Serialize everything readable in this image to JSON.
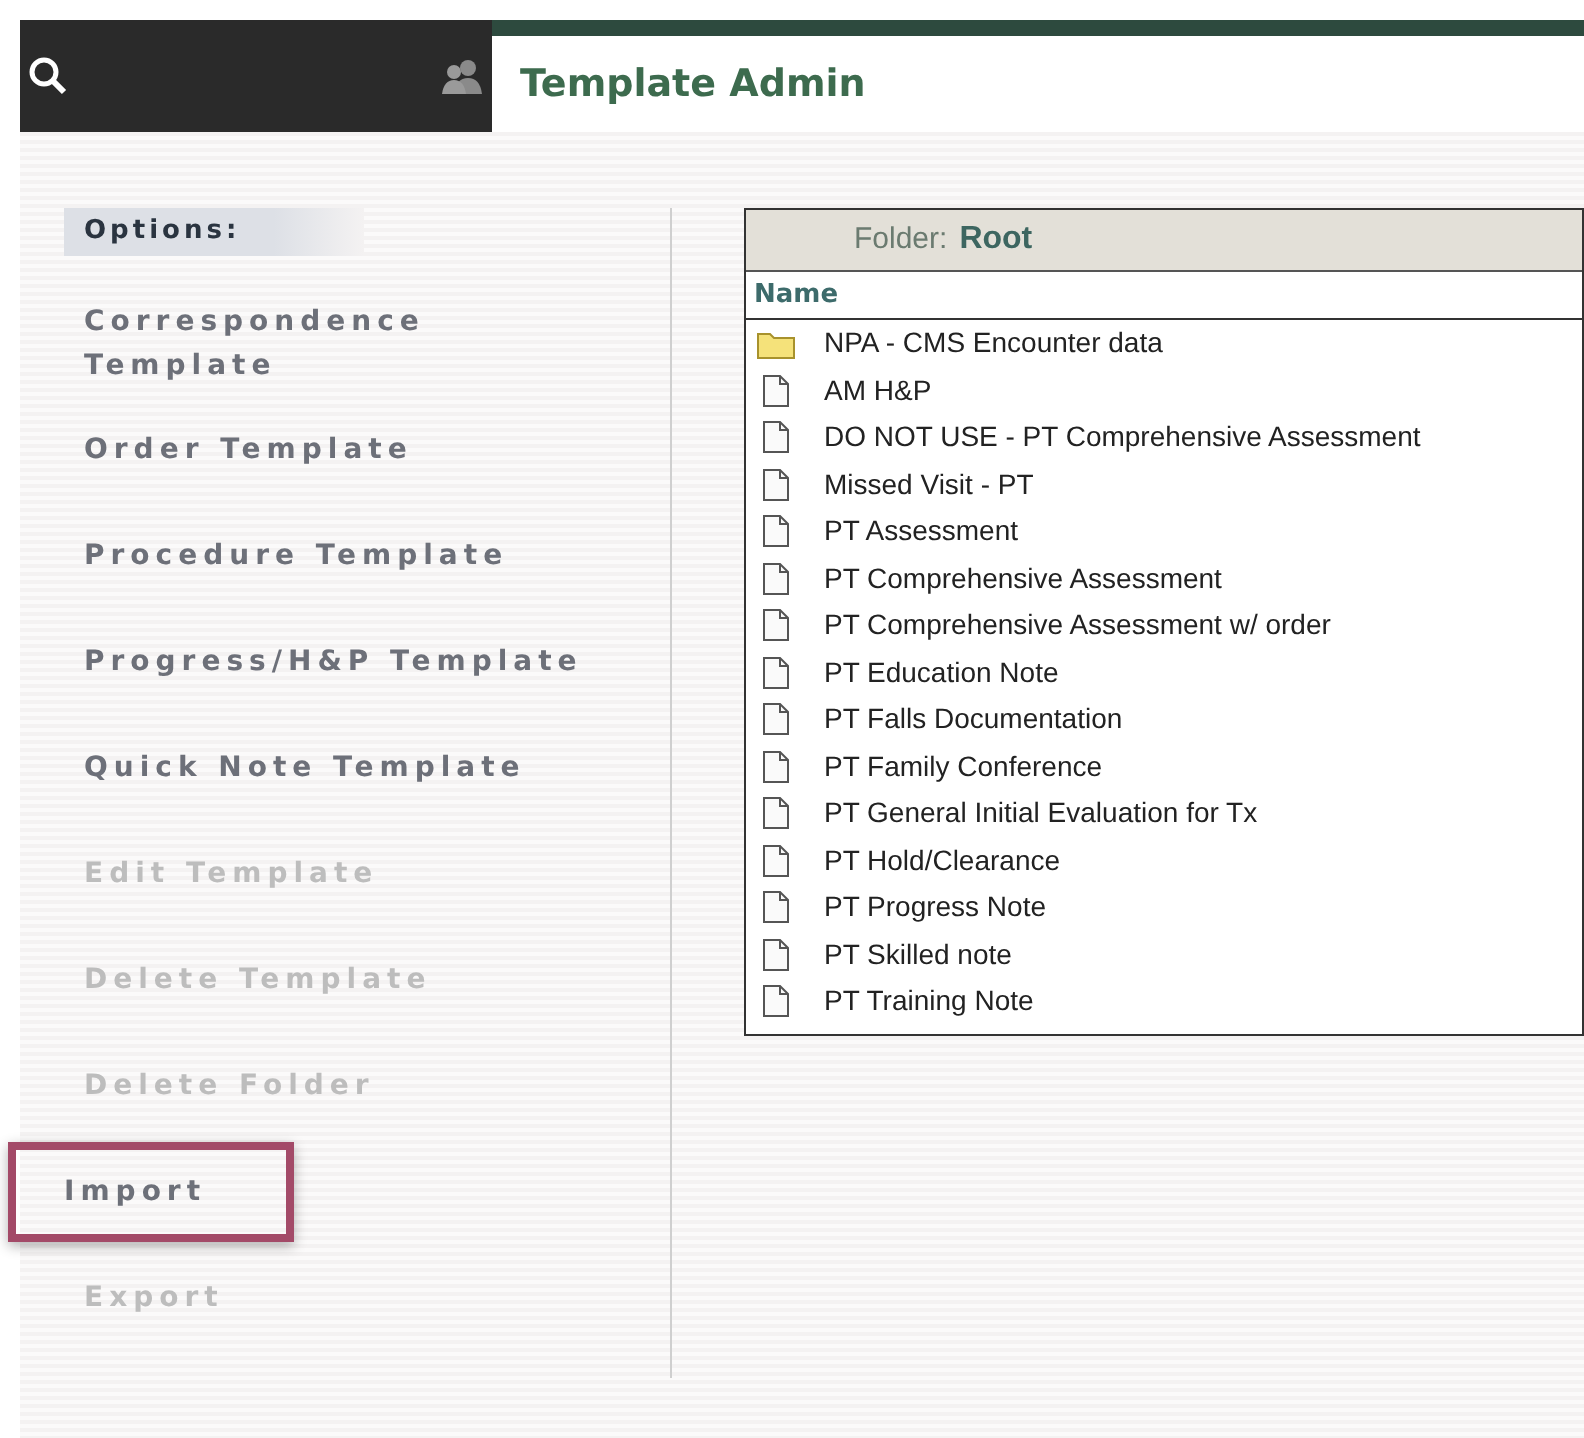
{
  "header": {
    "title": "Template Admin"
  },
  "options": {
    "heading": "Options:",
    "items": [
      {
        "label": "Correspondence Template",
        "disabled": false,
        "highlighted": false
      },
      {
        "label": "Order Template",
        "disabled": false,
        "highlighted": false
      },
      {
        "label": "Procedure Template",
        "disabled": false,
        "highlighted": false
      },
      {
        "label": "Progress/H&P Template",
        "disabled": false,
        "highlighted": false
      },
      {
        "label": "Quick Note Template",
        "disabled": false,
        "highlighted": false
      },
      {
        "label": "Edit Template",
        "disabled": true,
        "highlighted": false
      },
      {
        "label": "Delete Template",
        "disabled": true,
        "highlighted": false
      },
      {
        "label": "Delete Folder",
        "disabled": true,
        "highlighted": false
      },
      {
        "label": "Import",
        "disabled": false,
        "highlighted": true
      },
      {
        "label": "Export",
        "disabled": true,
        "highlighted": false
      }
    ]
  },
  "folder": {
    "label": "Folder:",
    "name": "Root",
    "column": "Name",
    "rows": [
      {
        "kind": "folder",
        "name": "NPA - CMS Encounter data"
      },
      {
        "kind": "file",
        "name": "AM H&P"
      },
      {
        "kind": "file",
        "name": "DO NOT USE - PT Comprehensive Assessment"
      },
      {
        "kind": "file",
        "name": "Missed Visit - PT"
      },
      {
        "kind": "file",
        "name": "PT Assessment"
      },
      {
        "kind": "file",
        "name": "PT Comprehensive Assessment"
      },
      {
        "kind": "file",
        "name": "PT Comprehensive Assessment w/ order"
      },
      {
        "kind": "file",
        "name": "PT Education Note"
      },
      {
        "kind": "file",
        "name": "PT Falls Documentation"
      },
      {
        "kind": "file",
        "name": "PT Family Conference"
      },
      {
        "kind": "file",
        "name": "PT General Initial Evaluation for Tx"
      },
      {
        "kind": "file",
        "name": "PT Hold/Clearance"
      },
      {
        "kind": "file",
        "name": "PT Progress Note"
      },
      {
        "kind": "file",
        "name": "PT Skilled note"
      },
      {
        "kind": "file",
        "name": "PT Training Note"
      }
    ]
  }
}
